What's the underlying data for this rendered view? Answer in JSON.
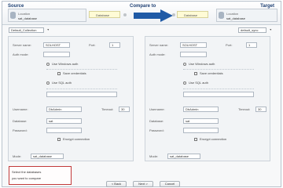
{
  "header": {
    "source_title": "Source",
    "compare_title": "Compare to",
    "target_title": "Target",
    "source_conn": {
      "line1": "Location",
      "line2": "sat_database"
    },
    "target_conn": {
      "line1": "Location",
      "line2": "sat_database"
    },
    "source_version": "Database",
    "target_version": "Database"
  },
  "selectors": {
    "left": {
      "value": "Default_Collection",
      "placeholder": ""
    },
    "right": {
      "value": "default_sync"
    }
  },
  "left_panel": {
    "server_name_label": "Server name:",
    "server_name_value": "SOLHOST",
    "port_label": "Port:",
    "port_value": "1",
    "auth_label": "Auth mode:",
    "auth_value": "",
    "opt_windows": "Use Windows auth",
    "opt_sql": "Use SQL auth",
    "chk_save": "Save credentials",
    "user_label": "Username:",
    "user_value": "DbAdmin",
    "timeout_label": "Timeout:",
    "timeout_value": "30",
    "db_label": "Database:",
    "db_value": "sat",
    "password_label": "Password:",
    "password_value": "",
    "chk_encrypt": "Encrypt connection",
    "mode_label": "Mode:",
    "mode_value": "sat_database"
  },
  "right_panel": {
    "server_name_label": "Server name:",
    "server_name_value": "SOLHOST",
    "port_label": "Port:",
    "port_value": "1",
    "auth_label": "Auth mode:",
    "auth_value": "",
    "opt_windows": "Use Windows auth",
    "opt_sql": "Use SQL auth",
    "chk_save": "Save credentials",
    "user_label": "Username:",
    "user_value": "DbAdmin",
    "timeout_label": "Timeout:",
    "timeout_value": "30",
    "db_label": "Database:",
    "db_value": "sat",
    "password_label": "Password:",
    "password_value": "",
    "chk_encrypt": "Encrypt connection",
    "mode_label": "Mode:",
    "mode_value": "sat_database"
  },
  "note": {
    "line1": "Select the databases",
    "line2": "you want to compare"
  },
  "buttons": {
    "back": "< Back",
    "next": "Next >",
    "cancel": "Cancel"
  },
  "colors": {
    "accent": "#1f5aa6",
    "title": "#1d3f73",
    "note_border": "#c23a3a"
  }
}
